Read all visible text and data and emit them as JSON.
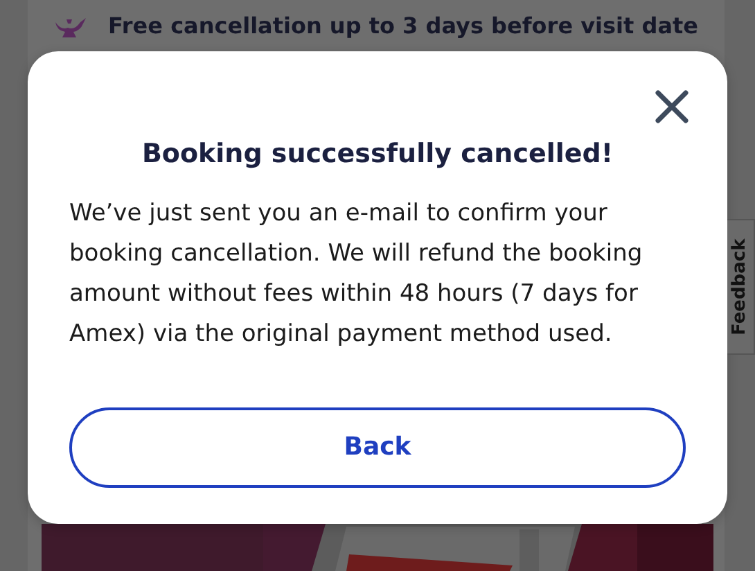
{
  "background": {
    "heading": "Free cancellation up to 3 days before visit date"
  },
  "dialog": {
    "title": "Booking successfully cancelled!",
    "message": "We’ve just sent you an e-mail to confirm your booking cancellation. We will refund the booking amount without fees within 48 hours (7 days for Amex) via the original payment method used.",
    "button": "Back"
  },
  "feedback_tab": {
    "label": "Feedback"
  }
}
